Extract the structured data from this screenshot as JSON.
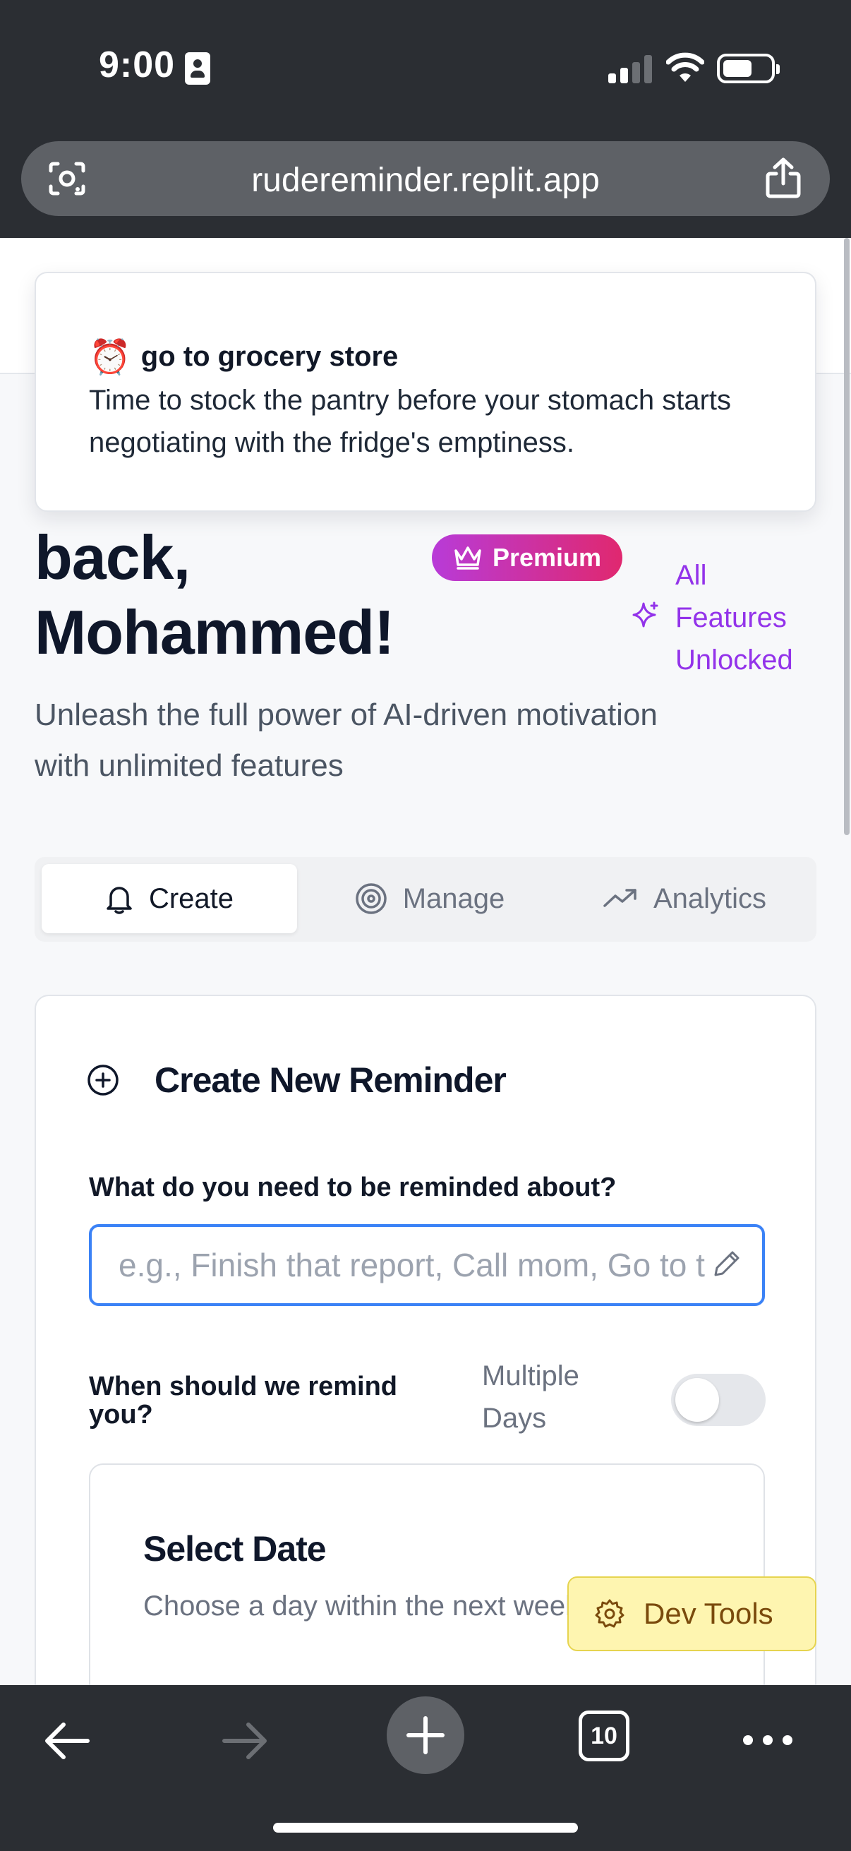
{
  "status_bar": {
    "time": "9:00"
  },
  "browser": {
    "url": "rudereminder.replit.app",
    "tab_count": "10"
  },
  "toast": {
    "title": "go to grocery store",
    "body": "Time to stock the pantry before your stomach starts negotiating with the fridge's emptiness."
  },
  "hero": {
    "welcome_line1": "back,",
    "welcome_line2": "Mohammed!",
    "premium_label": "Premium",
    "features_label": "All Features Unlocked",
    "subtitle": "Unleash the full power of AI-driven motivation with unlimited features"
  },
  "tabs": [
    {
      "label": "Create",
      "icon": "bell-icon",
      "active": true
    },
    {
      "label": "Manage",
      "icon": "target-icon",
      "active": false
    },
    {
      "label": "Analytics",
      "icon": "trending-up-icon",
      "active": false
    }
  ],
  "form": {
    "title": "Create New Reminder",
    "reminder_label": "What do you need to be reminded about?",
    "reminder_placeholder": "e.g., Finish that report, Call mom, Go to the gym",
    "reminder_value": "",
    "when_label": "When should we remind you?",
    "multiple_days_label": "Multiple Days",
    "multiple_days_enabled": false,
    "date_title": "Select Date",
    "date_subtitle": "Choose a day within the next week"
  },
  "dev_tools": {
    "label": "Dev Tools"
  },
  "colors": {
    "accent_blue": "#3b82f6",
    "premium_gradient_start": "#b83bd8",
    "premium_gradient_end": "#e0286f",
    "features_purple": "#9333ea",
    "dev_tools_bg": "#fef5b0"
  }
}
